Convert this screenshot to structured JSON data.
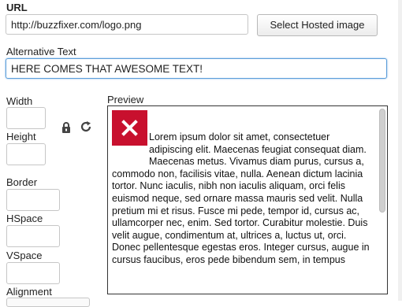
{
  "url": {
    "label": "URL",
    "value": "http://buzzfixer.com/logo.png",
    "select_button": "Select Hosted image"
  },
  "alt": {
    "label": "Alternative Text",
    "value": "HERE COMES THAT AWESOME TEXT!"
  },
  "dims": {
    "width_label": "Width",
    "height_label": "Height",
    "width_value": "",
    "height_value": ""
  },
  "border": {
    "label": "Border",
    "value": ""
  },
  "hspace": {
    "label": "HSpace",
    "value": ""
  },
  "vspace": {
    "label": "VSpace",
    "value": ""
  },
  "alignment": {
    "label": "Alignment"
  },
  "preview": {
    "label": "Preview",
    "text": "Lorem ipsum dolor sit amet, consectetuer adipiscing elit. Maecenas feugiat consequat diam. Maecenas metus. Vivamus diam purus, cursus a, commodo non, facilisis vitae, nulla. Aenean dictum lacinia tortor. Nunc iaculis, nibh non iaculis aliquam, orci felis euismod neque, sed ornare massa mauris sed velit. Nulla pretium mi et risus. Fusce mi pede, tempor id, cursus ac, ullamcorper nec, enim. Sed tortor. Curabitur molestie. Duis velit augue, condimentum at, ultrices a, luctus ut, orci. Donec pellentesque egestas eros. Integer cursus, augue in cursus faucibus, eros pede bibendum sem, in tempus"
  },
  "icons": {
    "lock": "lock-icon",
    "reset": "reset-icon",
    "broken_image": "close-icon"
  },
  "colors": {
    "focus_border": "#5b9dd9",
    "broken_image_bg": "#c8102e"
  }
}
